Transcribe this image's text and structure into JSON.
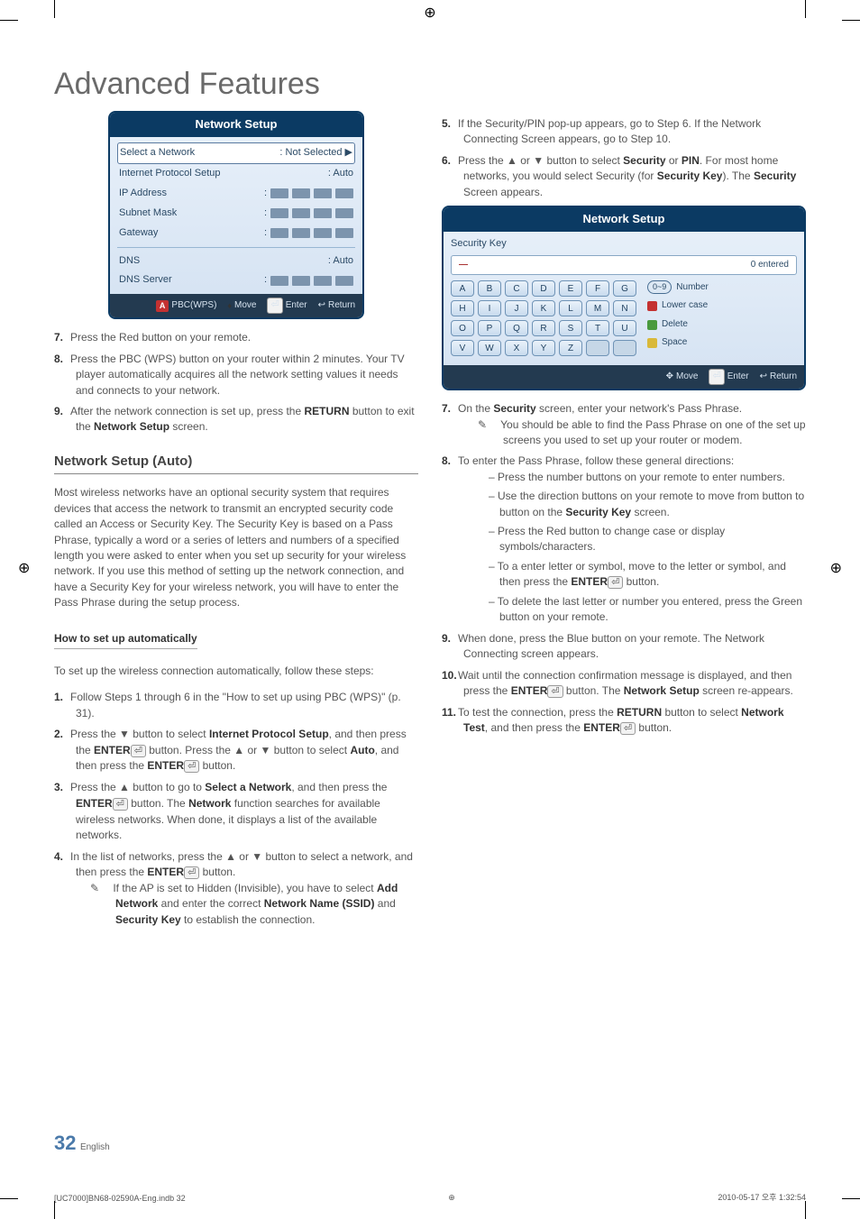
{
  "title": "Advanced Features",
  "osd1": {
    "header": "Network Setup",
    "rows": {
      "select_network": {
        "label": "Select a Network",
        "value": ": Not Selected  ▶"
      },
      "ip_setup": {
        "label": "Internet Protocol Setup",
        "value": ": Auto"
      },
      "ip_address": {
        "label": "IP Address",
        "colon": ":"
      },
      "subnet": {
        "label": "Subnet Mask",
        "colon": ":"
      },
      "gateway": {
        "label": "Gateway",
        "colon": ":"
      },
      "dns": {
        "label": "DNS",
        "value": ": Auto"
      },
      "dns_server": {
        "label": "DNS Server",
        "colon": ":"
      }
    },
    "footer": {
      "pbc": "PBC(WPS)",
      "move": "Move",
      "enter": "Enter",
      "return": "Return"
    }
  },
  "left_steps": {
    "s7": "Press the Red button on your remote.",
    "s8": "Press the PBC (WPS) button on your router within 2 minutes. Your TV player automatically acquires all the network setting values it needs and connects to your network.",
    "s9_a": "After the network connection is set up, press the ",
    "s9_b": "RETURN",
    "s9_c": " button to exit the ",
    "s9_d": "Network Setup",
    "s9_e": " screen."
  },
  "auto": {
    "heading": "Network Setup (Auto)",
    "intro": "Most wireless networks have an optional security system that requires devices that access the network to transmit an encrypted security code called an Access or Security Key. The Security Key is based on a Pass Phrase, typically a word or a series of letters and numbers of a specified length you were asked to enter when you set up security for your wireless network.  If you use this method of setting up the network connection, and have a Security Key for your wireless network, you will have to enter the Pass Phrase during the setup process.",
    "sub": "How to set up automatically",
    "lead": "To set up the wireless connection automatically, follow these steps:",
    "s1": "Follow Steps 1 through 6 in the \"How to set up using PBC (WPS)\" (p. 31).",
    "s2_a": "Press the ▼ button to select ",
    "s2_b": "Internet Protocol Setup",
    "s2_c": ", and then press the ",
    "s2_enter": "ENTER",
    "s2_d": " button. Press the ▲ or ▼ button to select ",
    "s2_e": "Auto",
    "s2_f": ", and then press the ",
    "s2_g": " button.",
    "s3_a": "Press the ▲ button to go to ",
    "s3_b": "Select a Network",
    "s3_c": ", and then press the ",
    "s3_d": " button. The ",
    "s3_e": "Network",
    "s3_f": " function searches for available wireless networks. When done, it displays a list of the available networks.",
    "s4_a": "In the list of networks, press the ▲ or ▼ button to select a network, and then press the ",
    "s4_b": " button.",
    "s4_note_a": "If the AP is set to Hidden (Invisible), you have to select ",
    "s4_note_b": "Add Network",
    "s4_note_c": " and enter the correct ",
    "s4_note_d": "Network Name (SSID)",
    "s4_note_e": " and ",
    "s4_note_f": "Security Key",
    "s4_note_g": " to establish the connection."
  },
  "right_top": {
    "s5": "If the Security/PIN pop-up appears, go to Step 6. If the Network Connecting Screen appears, go to Step 10.",
    "s6_a": "Press the ▲ or ▼ button to select ",
    "s6_b": "Security",
    "s6_c": " or ",
    "s6_d": "PIN",
    "s6_e": ". For most home networks, you would select Security (for ",
    "s6_f": "Security Key",
    "s6_g": "). The ",
    "s6_h": "Security",
    "s6_i": " Screen appears."
  },
  "osd2": {
    "header": "Network Setup",
    "sec_label": "Security Key",
    "entered": "0 entered",
    "keys_r1": [
      "A",
      "B",
      "C",
      "D",
      "E",
      "F",
      "G"
    ],
    "keys_r2": [
      "H",
      "I",
      "J",
      "K",
      "L",
      "M",
      "N"
    ],
    "keys_r3": [
      "O",
      "P",
      "Q",
      "R",
      "S",
      "T",
      "U"
    ],
    "keys_r4": [
      "V",
      "W",
      "X",
      "Y",
      "Z",
      "",
      ""
    ],
    "legend": {
      "number": "Number",
      "lower": "Lower case",
      "delete": "Delete",
      "space": "Space",
      "pill": "0~9"
    },
    "footer": {
      "move": "Move",
      "enter": "Enter",
      "return": "Return"
    }
  },
  "right_steps": {
    "s7_a": "On the ",
    "s7_b": "Security",
    "s7_c": " screen, enter your network's Pass Phrase.",
    "s7_note": "You should be able to find the Pass Phrase on one of the set up screens you used to set up your router or modem.",
    "s8": "To enter the Pass Phrase, follow these general directions:",
    "s8_d1": "Press the number buttons on your remote to enter numbers.",
    "s8_d2_a": "Use the direction buttons on your remote to move from button to button on the ",
    "s8_d2_b": "Security Key",
    "s8_d2_c": " screen.",
    "s8_d3": "Press the Red button to change case or display symbols/characters.",
    "s8_d4_a": "To a enter letter or symbol, move to the letter or symbol, and then press the ",
    "s8_d4_b": "ENTER",
    "s8_d4_c": " button.",
    "s8_d5": "To delete the last letter or number you entered, press the Green button on your remote.",
    "s9": "When done, press the Blue button on your remote. The Network Connecting screen appears.",
    "s10_a": "Wait until the connection confirmation message is displayed, and then press the ",
    "s10_b": "ENTER",
    "s10_c": " button. The ",
    "s10_d": "Network Setup",
    "s10_e": " screen re-appears.",
    "s11_a": "To test the connection, press the ",
    "s11_b": "RETURN",
    "s11_c": " button to select ",
    "s11_d": "Network Test",
    "s11_e": ", and then press the ",
    "s11_f": "ENTER",
    "s11_g": " button."
  },
  "footer": {
    "page": "32",
    "lang": "English",
    "file": "[UC7000]BN68-02590A-Eng.indb   32",
    "date": "2010-05-17   오후 1:32:54"
  },
  "glyph": {
    "updown": "▲▼",
    "lrud": "✥",
    "enter_icon": "⏎",
    "return": "↩",
    "note": "✎",
    "cursor": "—"
  }
}
